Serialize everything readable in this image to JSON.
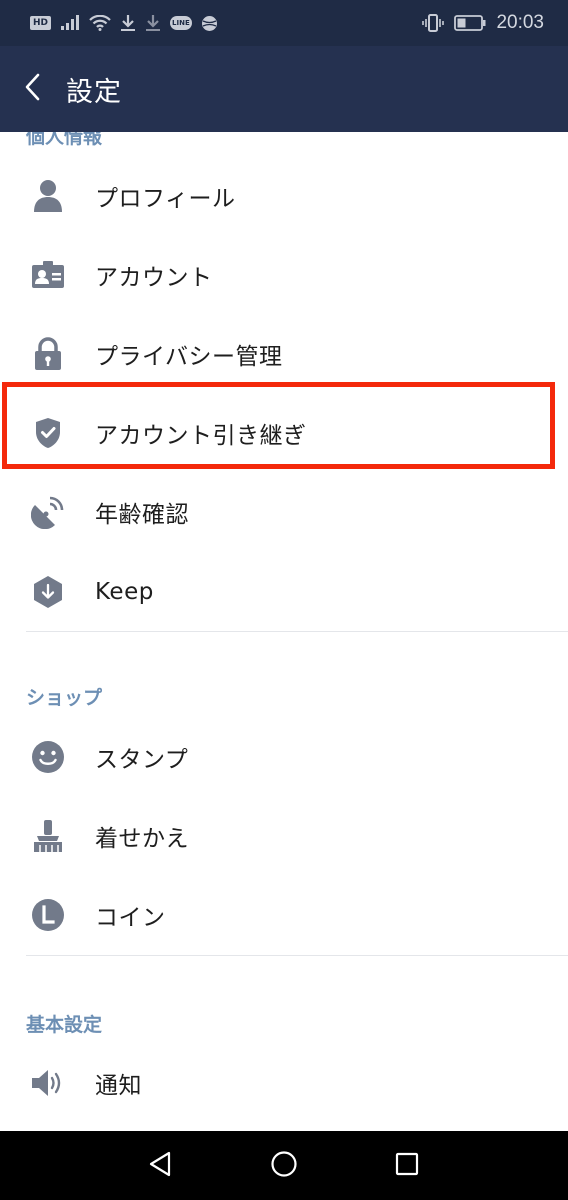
{
  "status_bar": {
    "hd": "HD",
    "line": "LINE",
    "time": "20:03",
    "icons": [
      "hd-icon",
      "signal-icon",
      "wifi-icon",
      "download-icon",
      "download-icon",
      "line-notification-icon",
      "sports-ball-icon",
      "vibrate-icon",
      "battery-icon"
    ]
  },
  "header": {
    "title": "設定",
    "back_icon": "chevron-left-icon"
  },
  "sections": {
    "personal": {
      "title": "個人情報",
      "items": [
        {
          "label": "プロフィール",
          "icon": "person-icon"
        },
        {
          "label": "アカウント",
          "icon": "id-card-icon"
        },
        {
          "label": "プライバシー管理",
          "icon": "lock-icon"
        },
        {
          "label": "アカウント引き継ぎ",
          "icon": "shield-check-icon"
        },
        {
          "label": "年齢確認",
          "icon": "satellite-dish-icon"
        },
        {
          "label": "Keep",
          "icon": "keep-download-icon"
        }
      ]
    },
    "shop": {
      "title": "ショップ",
      "items": [
        {
          "label": "スタンプ",
          "icon": "smiley-icon"
        },
        {
          "label": "着せかえ",
          "icon": "paint-brush-icon"
        },
        {
          "label": "コイン",
          "icon": "coin-icon"
        }
      ]
    },
    "basic": {
      "title": "基本設定",
      "items": [
        {
          "label": "通知",
          "icon": "speaker-icon"
        }
      ]
    }
  },
  "highlight_color": "#f4290b",
  "colors": {
    "status_bar": "#1f2b45",
    "header": "#253150",
    "section_title": "#6d8fb4",
    "icon": "#727a8a"
  },
  "nav_bar": {
    "icons": [
      "back-triangle-icon",
      "home-circle-icon",
      "recents-square-icon"
    ]
  }
}
